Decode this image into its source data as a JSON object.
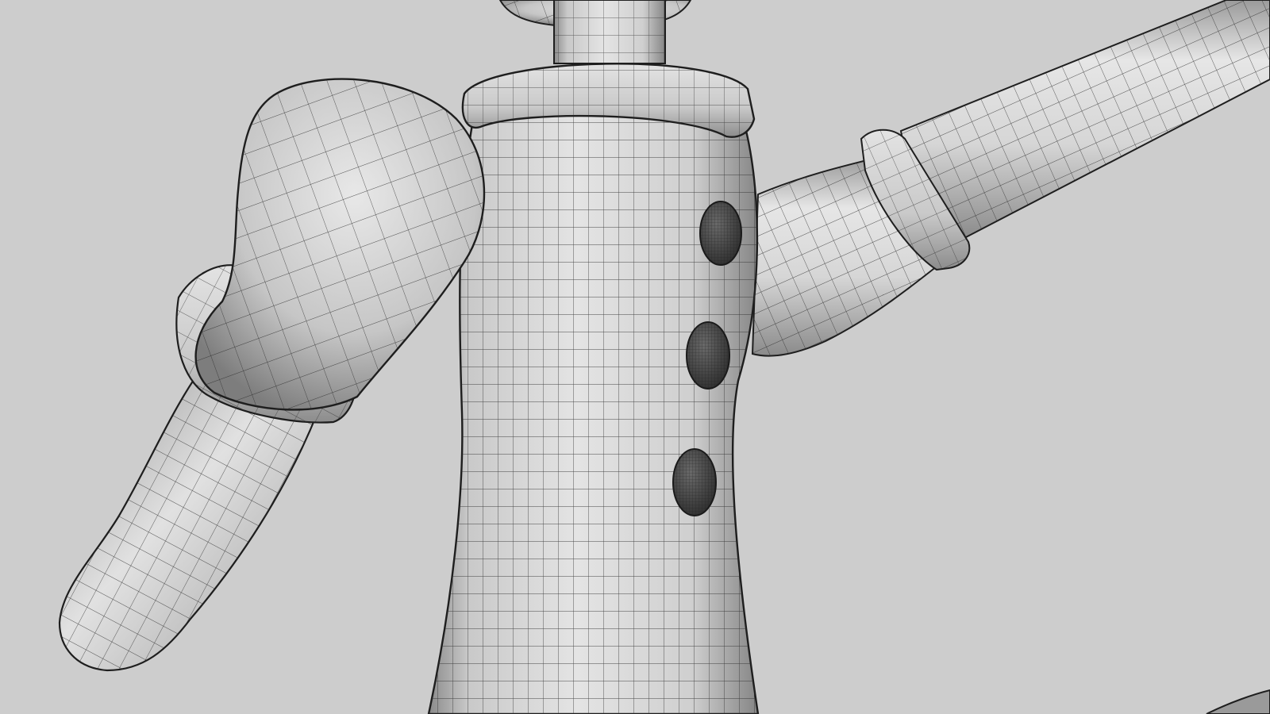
{
  "viewport": {
    "background": "#cdcdcd",
    "shading": "gray-smooth-shaded",
    "wireframe_on_shaded": true
  },
  "model": {
    "parts": [
      {
        "name": "neck",
        "icon": "cylinder"
      },
      {
        "name": "collar",
        "icon": "torus"
      },
      {
        "name": "torso",
        "icon": "capsule"
      },
      {
        "name": "left-upper-arm",
        "icon": "capsule"
      },
      {
        "name": "left-cuff",
        "icon": "ring"
      },
      {
        "name": "left-forearm",
        "icon": "capsule"
      },
      {
        "name": "right-upper-arm",
        "icon": "capsule"
      },
      {
        "name": "right-cuff",
        "icon": "ring"
      },
      {
        "name": "right-forearm",
        "icon": "capsule"
      }
    ],
    "buttons": 3
  },
  "colors": {
    "surface_light": "#e6e6e6",
    "surface_mid": "#bdbdbd",
    "surface_dark": "#7a7a7a",
    "wire": "#2a2a2a",
    "button": "#4a4a4a"
  }
}
